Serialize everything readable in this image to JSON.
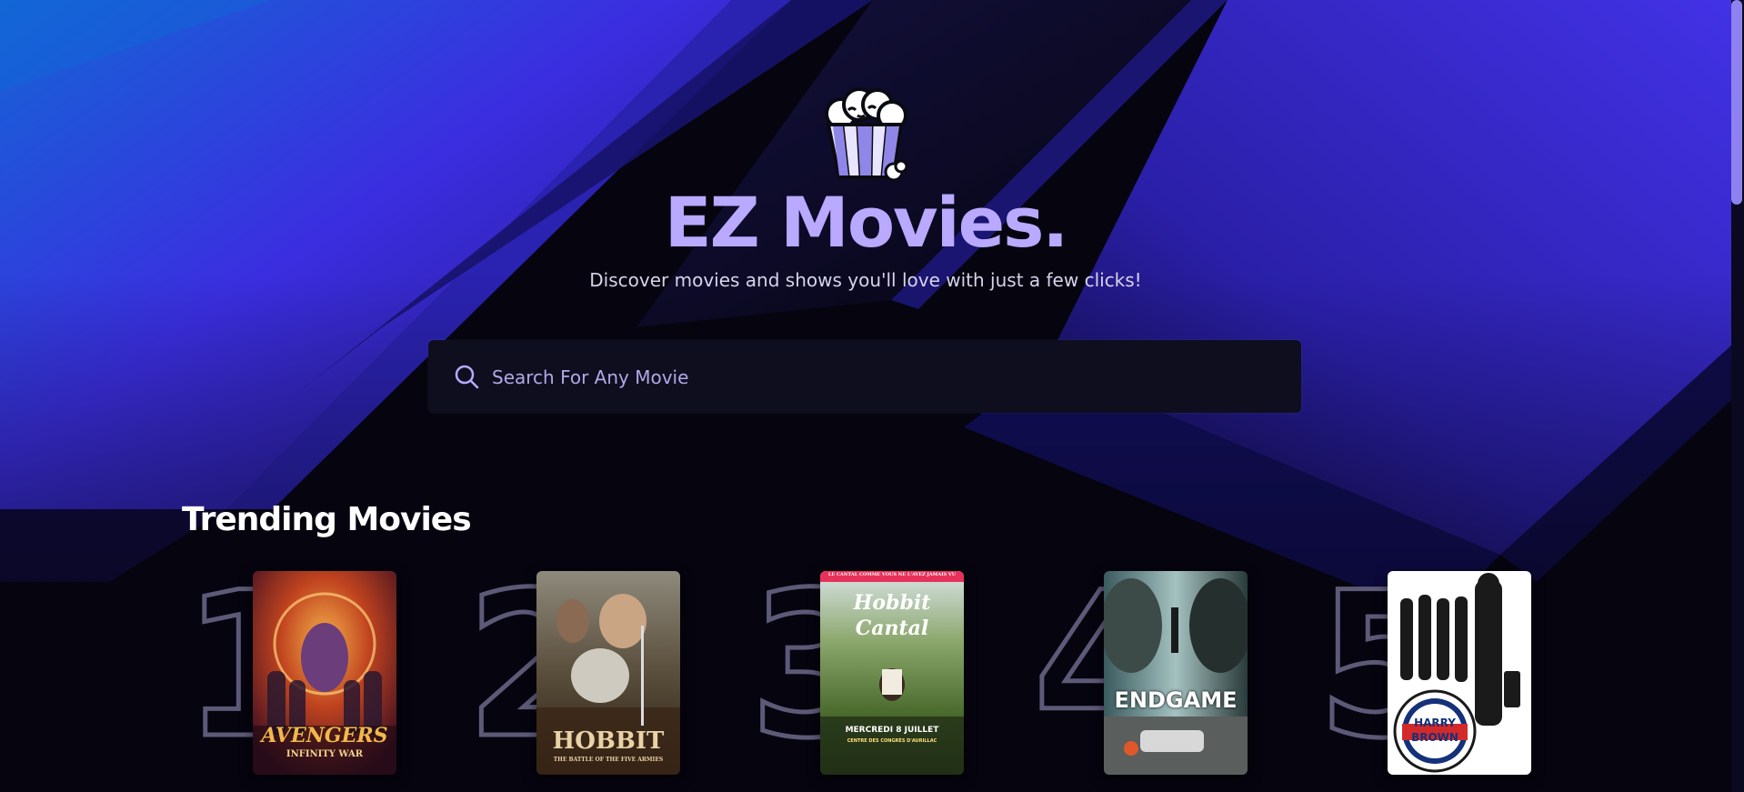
{
  "brand": {
    "name": "EZ Movies.",
    "tagline": "Discover movies and shows you'll love with just a few clicks!",
    "logo_icon": "popcorn-icon"
  },
  "search": {
    "placeholder": "Search For Any Movie",
    "value": "",
    "icon": "search-icon"
  },
  "trending": {
    "title": "Trending Movies",
    "items": [
      {
        "rank": "1",
        "poster_title": "AVENGERS",
        "poster_subtitle": "INFINITY WAR"
      },
      {
        "rank": "2",
        "poster_title": "HOBBIT",
        "poster_subtitle": "THE BATTLE OF THE FIVE ARMIES"
      },
      {
        "rank": "3",
        "poster_title": "Hobbit",
        "poster_subtitle": "Cantal",
        "poster_banner": "LE CANTAL COMME VOUS NE L'AVEZ JAMAIS VU",
        "poster_date": "MERCREDI 8 JUILLET",
        "poster_venue": "CENTRE DES CONGRÈS D'AURILLAC"
      },
      {
        "rank": "4",
        "poster_title": "ENDGAME"
      },
      {
        "rank": "5",
        "poster_title": "HARRY",
        "poster_subtitle": "BROWN"
      }
    ]
  },
  "colors": {
    "background": "#05040f",
    "accent": "#b9a9ff",
    "search_bg": "#0f0e1f",
    "rank_outline": "#5d5a78",
    "scrollbar": "#8d82f0"
  }
}
